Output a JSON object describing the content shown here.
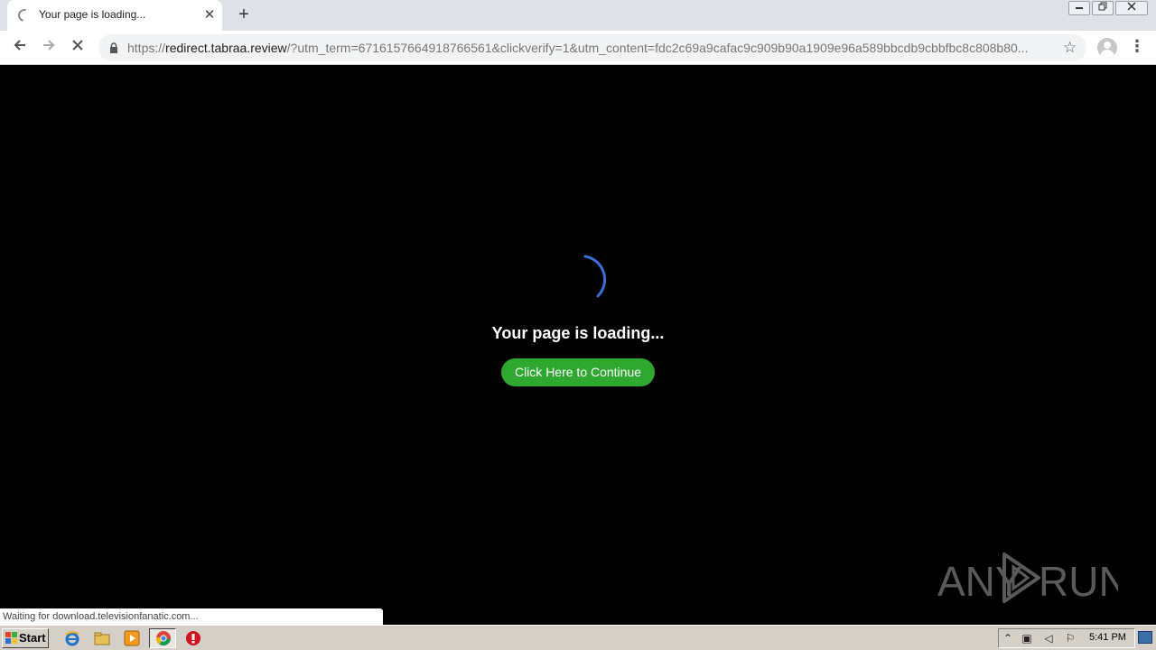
{
  "browser": {
    "tab": {
      "title": "Your page is loading..."
    },
    "new_tab_symbol": "+",
    "address": {
      "scheme": "https://",
      "host": "redirect.tabraa.review",
      "path": "/?utm_term=6716157664918766561&clickverify=1&utm_content=fdc2c69a9cafac9c909b90a1909e96a589bbcdb9cbbfbc8c808b80..."
    },
    "status_text": "Waiting for download.televisionfanatic.com..."
  },
  "page": {
    "loading_text": "Your page is loading...",
    "continue_label": "Click Here to Continue",
    "spinner_color": "#3b6fd6",
    "button_color": "#2fa82f"
  },
  "watermark": {
    "text_left": "ANY",
    "text_right": "RUN"
  },
  "taskbar": {
    "start_label": "Start",
    "clock": "5:41 PM",
    "pinned_icons": [
      "internet-explorer-icon",
      "file-explorer-icon",
      "media-player-icon",
      "chrome-icon",
      "opera-icon"
    ]
  }
}
